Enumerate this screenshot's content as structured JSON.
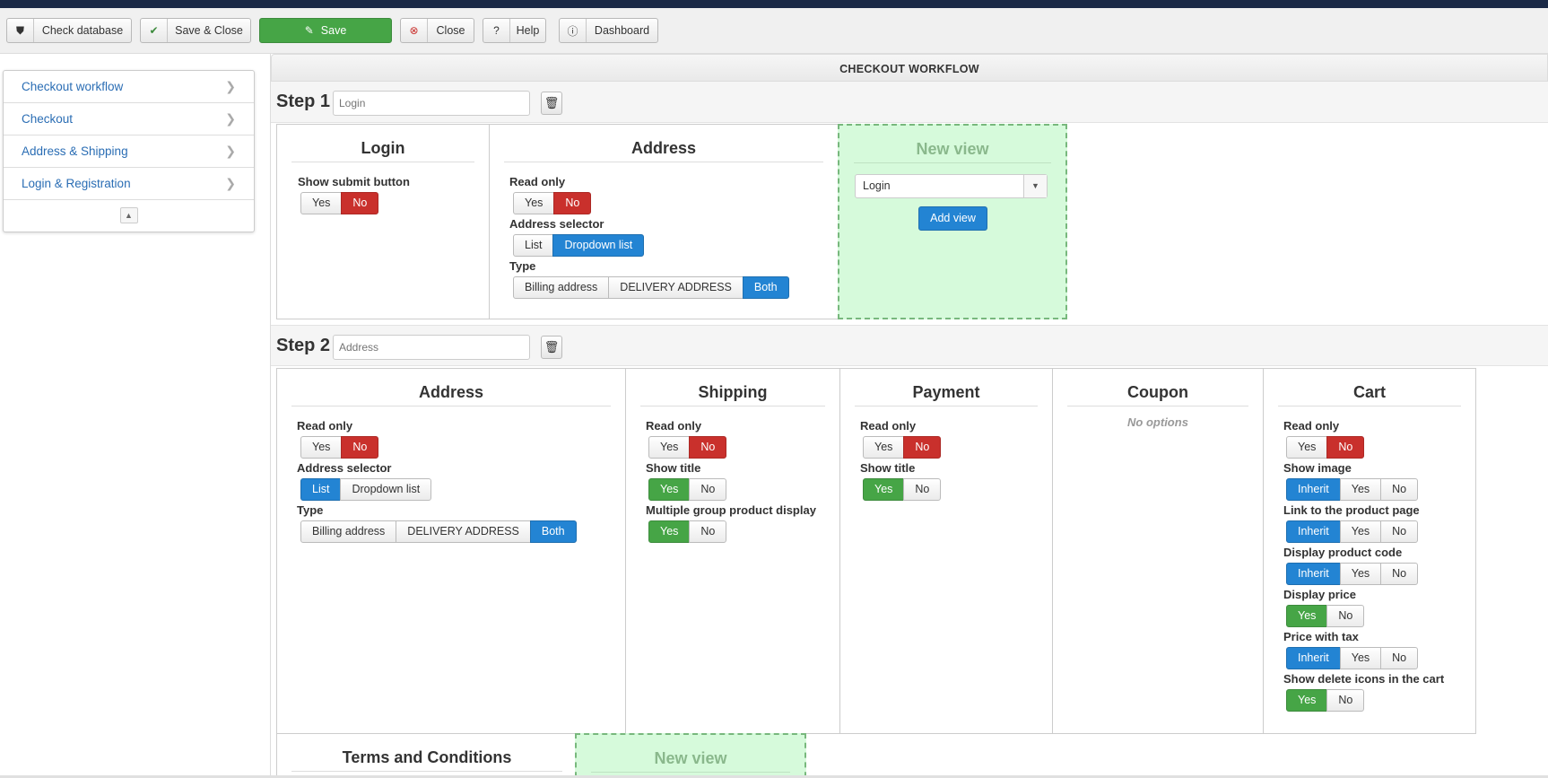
{
  "toolbar": {
    "buttons": [
      {
        "label": "Check database",
        "icon": "shield-icon"
      },
      {
        "label": "Save & Close",
        "icon": "checkmark-icon"
      },
      {
        "label": "Save",
        "icon": "edit-icon"
      },
      {
        "label": "Close",
        "icon": "close-circle-icon"
      },
      {
        "label": "Help",
        "icon": "question-icon"
      },
      {
        "label": "Dashboard",
        "icon": "dashboard-icon"
      }
    ]
  },
  "sidebar": {
    "items": [
      {
        "label": "Checkout workflow"
      },
      {
        "label": "Checkout"
      },
      {
        "label": "Address & Shipping"
      },
      {
        "label": "Login & Registration"
      }
    ]
  },
  "main": {
    "header": "CHECKOUT WORKFLOW",
    "step1": {
      "label": "Step 1",
      "name_placeholder": "Login",
      "login": {
        "title": "Login",
        "show_submit_label": "Show submit button",
        "yes": "Yes",
        "no": "No"
      },
      "address": {
        "title": "Address",
        "read_only_label": "Read only",
        "yes": "Yes",
        "no": "No",
        "selector_label": "Address selector",
        "list": "List",
        "dropdown": "Dropdown list",
        "type_label": "Type",
        "billing": "Billing address",
        "delivery": "DELIVERY ADDRESS",
        "both": "Both"
      },
      "new_view": {
        "title": "New view",
        "selected": "Login",
        "add_label": "Add view"
      }
    },
    "step2": {
      "label": "Step 2",
      "name_placeholder": "Address",
      "address": {
        "title": "Address",
        "read_only_label": "Read only",
        "yes": "Yes",
        "no": "No",
        "selector_label": "Address selector",
        "list": "List",
        "dropdown": "Dropdown list",
        "type_label": "Type",
        "billing": "Billing address",
        "delivery": "DELIVERY ADDRESS",
        "both": "Both"
      },
      "shipping": {
        "title": "Shipping",
        "read_only_label": "Read only",
        "show_title_label": "Show title",
        "multi_group_label": "Multiple group product display",
        "yes": "Yes",
        "no": "No"
      },
      "payment": {
        "title": "Payment",
        "read_only_label": "Read only",
        "show_title_label": "Show title",
        "yes": "Yes",
        "no": "No"
      },
      "coupon": {
        "title": "Coupon",
        "no_options": "No options"
      },
      "cart": {
        "title": "Cart",
        "read_only_label": "Read only",
        "show_image_label": "Show image",
        "link_product_label": "Link to the product page",
        "display_code_label": "Display product code",
        "display_price_label": "Display price",
        "price_tax_label": "Price with tax",
        "delete_icons_label": "Show delete icons in the cart",
        "inherit": "Inherit",
        "yes": "Yes",
        "no": "No"
      },
      "terms": {
        "title": "Terms and Conditions"
      },
      "new_view": {
        "title": "New view"
      }
    }
  },
  "colors": {
    "red": "#c9302c",
    "blue": "#2384d3",
    "green": "#46a546",
    "new_view_bg": "#d6fadb"
  }
}
